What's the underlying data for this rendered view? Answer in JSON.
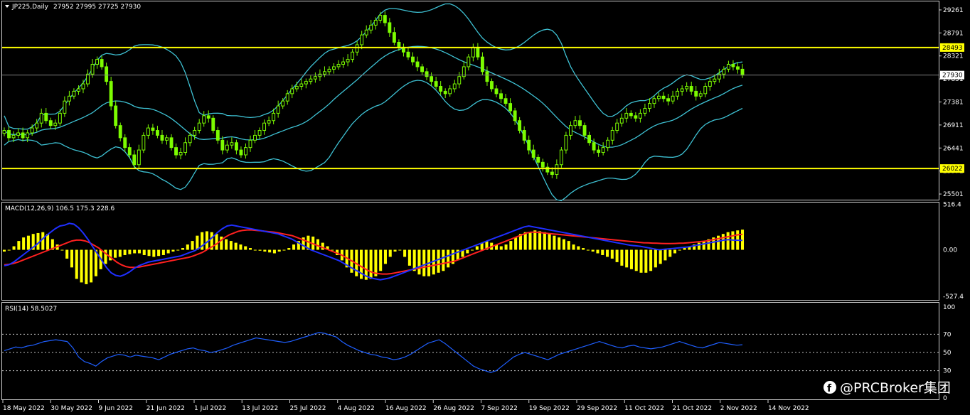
{
  "watermark": "@PRCBroker集团",
  "colors": {
    "background": "#000000",
    "frame": "#d0d0d0",
    "candle": "#7CFC00",
    "bollinger": "#3ec1d3",
    "hline": "#ffff00",
    "macd_hist": "#ffff00",
    "macd_main": "#1f2fff",
    "macd_signal": "#ff2020",
    "rsi": "#1f5fff",
    "level_box": "#ffff00",
    "price_box": "#ffffff"
  },
  "chart_data": [
    {
      "type": "candlestick",
      "title": "JP225,Daily",
      "ohlc_label": "27952 27995 27725 27930",
      "x_labels": [
        "18 May 2022",
        "30 May 2022",
        "9 Jun 2022",
        "21 Jun 2022",
        "1 Jul 2022",
        "13 Jul 2022",
        "25 Jul 2022",
        "4 Aug 2022",
        "16 Aug 2022",
        "26 Aug 2022",
        "7 Sep 2022",
        "19 Sep 2022",
        "29 Sep 2022",
        "11 Oct 2022",
        "21 Oct 2022",
        "2 Nov 2022",
        "14 Nov 2022"
      ],
      "y_ticks": [
        "29261",
        "28791",
        "28321",
        "27851",
        "27381",
        "26911",
        "26441",
        "25971",
        "25501"
      ],
      "ylim": [
        25400,
        29420
      ],
      "levels": [
        {
          "label": "28493",
          "value": 28493
        },
        {
          "label": "26022",
          "value": 26022
        }
      ],
      "last_price": {
        "label": "27930",
        "value": 27930
      },
      "close": [
        26800,
        26650,
        26700,
        26750,
        26650,
        26750,
        26850,
        26950,
        27150,
        27000,
        26900,
        26950,
        27150,
        27400,
        27500,
        27600,
        27650,
        27750,
        27950,
        28150,
        28250,
        28100,
        27800,
        27300,
        26900,
        26650,
        26450,
        26300,
        26100,
        26400,
        26700,
        26850,
        26800,
        26700,
        26600,
        26650,
        26450,
        26300,
        26350,
        26550,
        26700,
        26800,
        26950,
        27100,
        27050,
        26800,
        26600,
        26400,
        26500,
        26550,
        26400,
        26300,
        26450,
        26600,
        26700,
        26800,
        26950,
        27000,
        27150,
        27300,
        27400,
        27550,
        27650,
        27700,
        27750,
        27800,
        27850,
        27900,
        27950,
        28000,
        28050,
        28100,
        28150,
        28200,
        28250,
        28400,
        28550,
        28750,
        28850,
        28950,
        29050,
        29150,
        29000,
        28800,
        28600,
        28500,
        28400,
        28300,
        28200,
        28100,
        28000,
        27900,
        27800,
        27700,
        27600,
        27550,
        27650,
        27750,
        27900,
        28100,
        28300,
        28500,
        28300,
        28000,
        27800,
        27650,
        27550,
        27450,
        27350,
        27200,
        27000,
        26800,
        26600,
        26400,
        26250,
        26150,
        26050,
        25950,
        25900,
        26100,
        26400,
        26700,
        26900,
        27000,
        26900,
        26700,
        26550,
        26400,
        26350,
        26450,
        26600,
        26800,
        26950,
        27050,
        27150,
        27100,
        27050,
        27150,
        27250,
        27350,
        27450,
        27500,
        27450,
        27400,
        27500,
        27600,
        27650,
        27700,
        27600,
        27500,
        27550,
        27700,
        27800,
        27850,
        27950,
        28050,
        28150,
        28100,
        28050,
        27930
      ]
    },
    {
      "type": "line",
      "title": "MACD(12,26,9) 106.5 175.3 228.6",
      "y_ticks": [
        "516.4",
        "0.00",
        "-527.4"
      ],
      "ylim": [
        -560,
        520
      ],
      "series": [
        {
          "values": [
            -180,
            -170,
            -140,
            -100,
            -60,
            -20,
            20,
            60,
            110,
            160,
            200,
            240,
            270,
            280,
            300,
            290,
            250,
            190,
            120,
            40,
            -40,
            -120,
            -200,
            -260,
            -290,
            -300,
            -280,
            -250,
            -210,
            -180,
            -160,
            -140,
            -130,
            -120,
            -110,
            -100,
            -90,
            -80,
            -70,
            -50,
            -30,
            -10,
            20,
            60,
            100,
            150,
            200,
            240,
            270,
            280,
            270,
            260,
            250,
            240,
            230,
            220,
            210,
            200,
            190,
            180,
            160,
            140,
            120,
            90,
            60,
            30,
            0,
            -20,
            -40,
            -60,
            -80,
            -100,
            -120,
            -150,
            -180,
            -210,
            -240,
            -270,
            -300,
            -320,
            -330,
            -340,
            -330,
            -320,
            -300,
            -280,
            -260,
            -240,
            -220,
            -200,
            -180,
            -160,
            -140,
            -120,
            -100,
            -80,
            -60,
            -40,
            -20,
            0,
            20,
            40,
            60,
            80,
            100,
            120,
            140,
            160,
            180,
            200,
            220,
            240,
            260,
            270,
            260,
            250,
            240,
            230,
            220,
            210,
            200,
            190,
            180,
            170,
            160,
            150,
            140,
            130,
            120,
            110,
            100,
            90,
            80,
            70,
            60,
            50,
            45,
            40,
            30,
            20,
            10,
            0,
            5,
            10,
            15,
            20,
            25,
            30,
            40,
            50,
            60,
            70,
            80,
            90,
            100,
            110,
            115,
            110,
            108,
            106.5
          ]
        },
        {
          "values": [
            -170,
            -165,
            -155,
            -140,
            -120,
            -100,
            -80,
            -60,
            -40,
            -20,
            0,
            20,
            40,
            60,
            80,
            100,
            110,
            110,
            100,
            80,
            50,
            20,
            -20,
            -60,
            -100,
            -140,
            -170,
            -190,
            -200,
            -200,
            -195,
            -185,
            -175,
            -165,
            -155,
            -145,
            -135,
            -125,
            -115,
            -105,
            -95,
            -85,
            -70,
            -50,
            -30,
            0,
            30,
            60,
            100,
            140,
            170,
            190,
            210,
            220,
            225,
            225,
            220,
            215,
            210,
            205,
            200,
            190,
            180,
            170,
            160,
            140,
            120,
            100,
            80,
            60,
            40,
            20,
            0,
            -20,
            -40,
            -60,
            -90,
            -120,
            -150,
            -180,
            -210,
            -240,
            -260,
            -270,
            -275,
            -275,
            -270,
            -260,
            -250,
            -240,
            -230,
            -220,
            -210,
            -200,
            -190,
            -180,
            -170,
            -160,
            -150,
            -140,
            -130,
            -110,
            -90,
            -70,
            -50,
            -30,
            -10,
            10,
            30,
            50,
            70,
            90,
            110,
            130,
            150,
            170,
            190,
            200,
            200,
            195,
            190,
            185,
            180,
            175,
            170,
            165,
            160,
            155,
            150,
            145,
            140,
            135,
            130,
            125,
            120,
            115,
            110,
            105,
            100,
            95,
            90,
            85,
            80,
            78,
            76,
            74,
            72,
            70,
            70,
            72,
            74,
            76,
            80,
            85,
            90,
            95,
            100,
            110,
            120,
            130,
            140,
            150,
            160,
            170,
            175.3
          ]
        },
        {
          "values": [
            -20,
            0,
            40,
            100,
            140,
            160,
            180,
            190,
            200,
            180,
            120,
            60,
            0,
            -100,
            -200,
            -330,
            -370,
            -390,
            -370,
            -300,
            -220,
            -160,
            -120,
            -90,
            -80,
            -60,
            -50,
            -40,
            -40,
            -60,
            -70,
            -80,
            -70,
            -60,
            -40,
            -20,
            0,
            20,
            60,
            100,
            160,
            200,
            210,
            200,
            180,
            150,
            120,
            100,
            80,
            60,
            40,
            20,
            0,
            -10,
            -20,
            -30,
            -40,
            -20,
            0,
            20,
            60,
            100,
            140,
            160,
            150,
            120,
            80,
            40,
            0,
            -60,
            -120,
            -200,
            -260,
            -300,
            -330,
            -340,
            -330,
            -300,
            -240,
            -160,
            -80,
            -20,
            0,
            -80,
            -180,
            -240,
            -280,
            -300,
            -300,
            -280,
            -260,
            -240,
            -200,
            -160,
            -120,
            -80,
            -40,
            0,
            40,
            80,
            100,
            80,
            60,
            40,
            60,
            100,
            140,
            180,
            200,
            200,
            220,
            210,
            200,
            180,
            160,
            140,
            120,
            100,
            60,
            40,
            20,
            0,
            -20,
            -40,
            -60,
            -80,
            -100,
            -140,
            -180,
            -200,
            -220,
            -240,
            -260,
            -260,
            -240,
            -200,
            -160,
            -120,
            -80,
            -40,
            0,
            20,
            40,
            60,
            80,
            100,
            120,
            140,
            160,
            180,
            200,
            210,
            220,
            228.6
          ]
        }
      ]
    },
    {
      "type": "line",
      "title": "RSI(14) 58.5027",
      "y_ticks": [
        "100",
        "70",
        "50",
        "30",
        "0"
      ],
      "ylim": [
        0,
        100
      ],
      "series": [
        {
          "values": [
            52,
            54,
            56,
            55,
            57,
            58,
            60,
            62,
            63,
            64,
            63,
            62,
            55,
            45,
            40,
            38,
            35,
            40,
            44,
            46,
            48,
            47,
            45,
            47,
            46,
            45,
            44,
            42,
            45,
            48,
            50,
            52,
            54,
            55,
            53,
            52,
            50,
            51,
            53,
            55,
            58,
            60,
            62,
            64,
            66,
            65,
            64,
            63,
            62,
            61,
            62,
            64,
            66,
            68,
            70,
            72,
            71,
            69,
            67,
            62,
            58,
            55,
            52,
            50,
            48,
            47,
            45,
            44,
            42,
            43,
            45,
            48,
            52,
            56,
            60,
            62,
            64,
            60,
            55,
            50,
            45,
            40,
            35,
            32,
            30,
            28,
            30,
            35,
            40,
            45,
            48,
            50,
            48,
            46,
            44,
            42,
            45,
            48,
            50,
            52,
            54,
            56,
            58,
            60,
            62,
            60,
            58,
            56,
            55,
            57,
            58,
            56,
            55,
            54,
            55,
            56,
            58,
            60,
            62,
            60,
            58,
            56,
            55,
            57,
            59,
            61,
            60,
            59,
            58,
            58.5
          ]
        }
      ]
    }
  ]
}
